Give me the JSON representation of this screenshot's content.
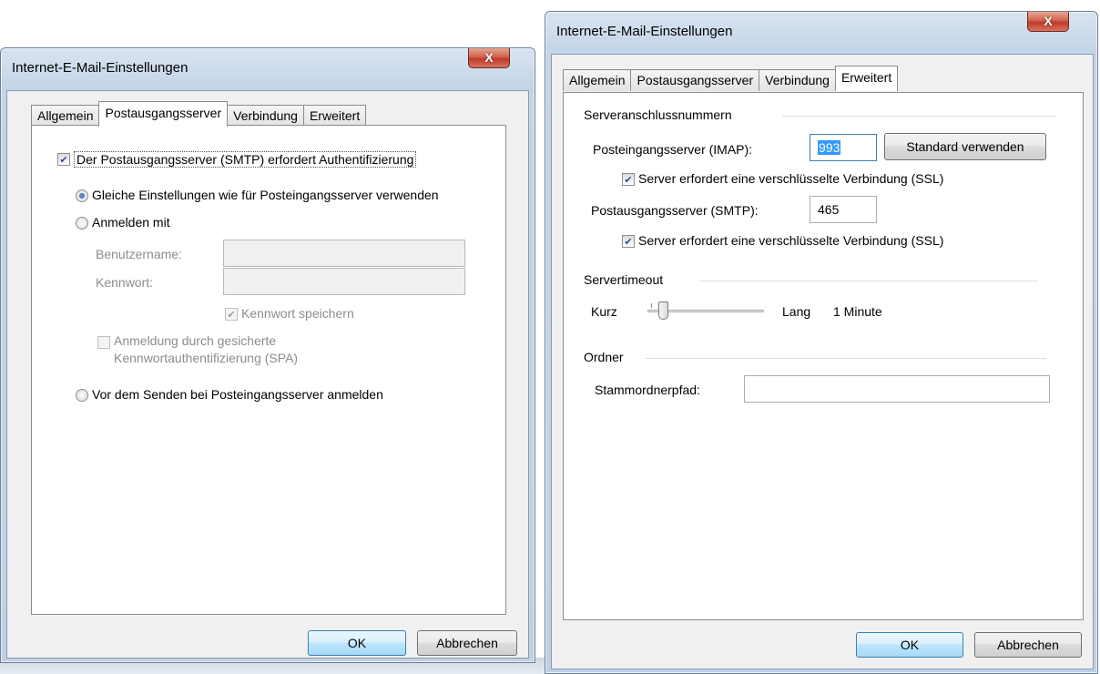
{
  "left_dialog": {
    "title": "Internet-E-Mail-Einstellungen",
    "close_label": "X",
    "tabs": [
      "Allgemein",
      "Postausgangsserver",
      "Verbindung",
      "Erweitert"
    ],
    "active_tab": "Postausgangsserver",
    "smtp_auth_checkbox": "Der Postausgangsserver (SMTP) erfordert Authentifizierung",
    "option_same_settings": "Gleiche Einstellungen wie für Posteingangsserver verwenden",
    "option_login_with": "Anmelden mit",
    "username_label": "Benutzername:",
    "password_label": "Kennwort:",
    "save_password_label": "Kennwort speichern",
    "spa_label_line1": "Anmeldung durch gesicherte",
    "spa_label_line2": "Kennwortauthentifizierung (SPA)",
    "option_login_before_send": "Vor dem Senden bei Posteingangsserver anmelden",
    "ok_label": "OK",
    "cancel_label": "Abbrechen"
  },
  "right_dialog": {
    "title": "Internet-E-Mail-Einstellungen",
    "close_label": "X",
    "tabs": [
      "Allgemein",
      "Postausgangsserver",
      "Verbindung",
      "Erweitert"
    ],
    "active_tab": "Erweitert",
    "section_ports": "Serveranschlussnummern",
    "imap_label": "Posteingangsserver (IMAP):",
    "imap_port": "993",
    "use_default_button": "Standard verwenden",
    "ssl_imap_label": "Server erfordert eine verschlüsselte Verbindung (SSL)",
    "smtp_label": "Postausgangsserver (SMTP):",
    "smtp_port": "465",
    "ssl_smtp_label": "Server erfordert eine verschlüsselte Verbindung (SSL)",
    "section_timeout": "Servertimeout",
    "timeout_short": "Kurz",
    "timeout_long": "Lang",
    "timeout_value": "1 Minute",
    "timeout_slider_level": 0.1,
    "section_folders": "Ordner",
    "root_folder_label": "Stammordnerpfad:",
    "root_folder_value": "",
    "ok_label": "OK",
    "cancel_label": "Abbrechen"
  }
}
